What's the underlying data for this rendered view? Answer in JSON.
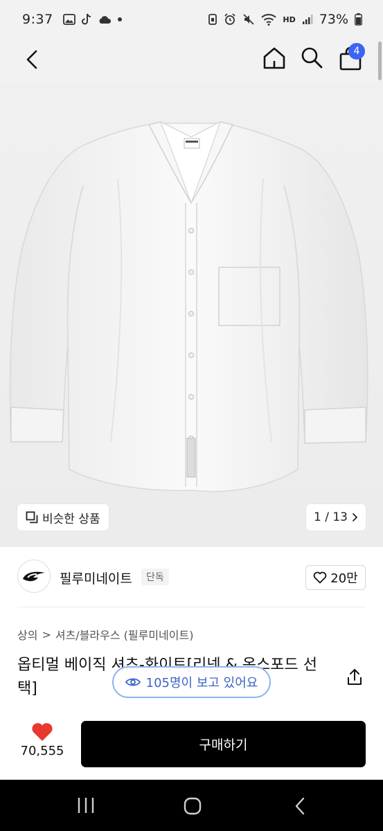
{
  "status_bar": {
    "time": "9:37",
    "battery": "73%",
    "network_label": "HD"
  },
  "header": {
    "cart_count": "4",
    "badge_color": "#3b66f5"
  },
  "gallery": {
    "similar_label": "비슷한 상품",
    "pager": "1 / 13"
  },
  "brand": {
    "name": "필루미네이트",
    "tag": "단독",
    "likes": "20만"
  },
  "breadcrumb": {
    "category": "상의",
    "separator": ">",
    "subcategory": "셔츠/블라우스 (필루미네이트)"
  },
  "product": {
    "title": "옵티멀 베이직 셔츠-화이트[리넨 & 옥스포드 선택]",
    "viewers": "105명이 보고 있어요"
  },
  "bottom": {
    "wish_count": "70,555",
    "buy_label": "구매하기",
    "heart_color": "#e8392f"
  }
}
